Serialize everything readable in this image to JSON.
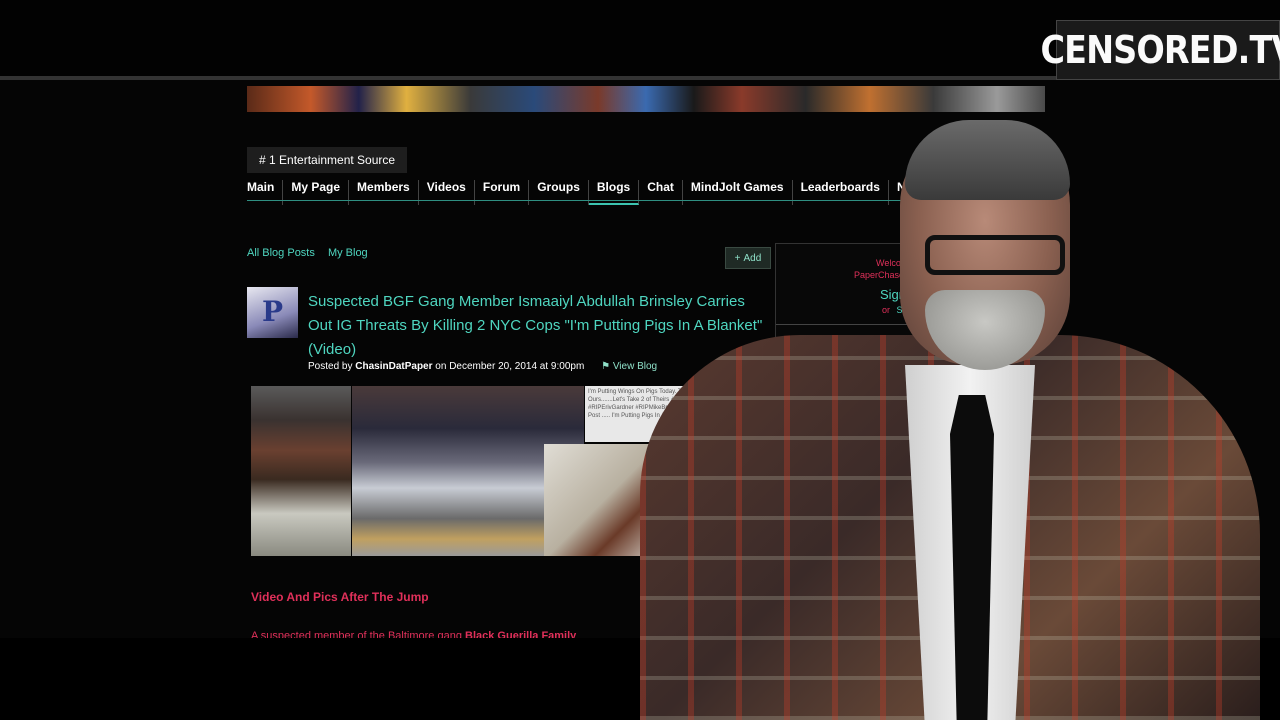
{
  "watermark": {
    "logo_text": "CENSORED.TV"
  },
  "site": {
    "tagline": "# 1 Entertainment Source",
    "nav": [
      "Main",
      "My Page",
      "Members",
      "Videos",
      "Forum",
      "Groups",
      "Blogs",
      "Chat",
      "MindJolt Games",
      "Leaderboards",
      "Notes"
    ],
    "active_nav": "Blogs"
  },
  "blog": {
    "all_posts_link": "All Blog Posts",
    "my_blog_link": "My Blog",
    "add_label": "Add",
    "post_title": "Suspected BGF Gang Member Ismaaiyl Abdullah Brinsley Carries Out IG Threats By Killing 2 NYC Cops \"I'm Putting Pigs In A Blanket\" (Video)",
    "posted_by_prefix": "Posted by",
    "author": "ChasinDatPaper",
    "date_text": "on December 20, 2014 at 9:00pm",
    "view_blog": "View Blog",
    "screenshot_caption": "I'm Putting Wings On Pigs Today. They Take 1 Of Ours.......Let's Take 2 of Theirs #ShootThePolice #RIPErivGardner #RIPMikeBrown This May Be My Final Post ..... I'm Putting Pigs In A Blanket",
    "jump_text": "Video And Pics After The Jump",
    "excerpt_text": "A suspected member of the Baltimore gang",
    "excerpt_bold": "Black Guerilla Family"
  },
  "sidebar": {
    "welcome": "Welcome",
    "user": "PaperChase",
    "sign_up": "Sign U",
    "or_text": "or",
    "sign_in": "Sign"
  },
  "colors": {
    "accent_teal": "#4fd6c0",
    "accent_red": "#e0305a",
    "background": "#050505"
  }
}
